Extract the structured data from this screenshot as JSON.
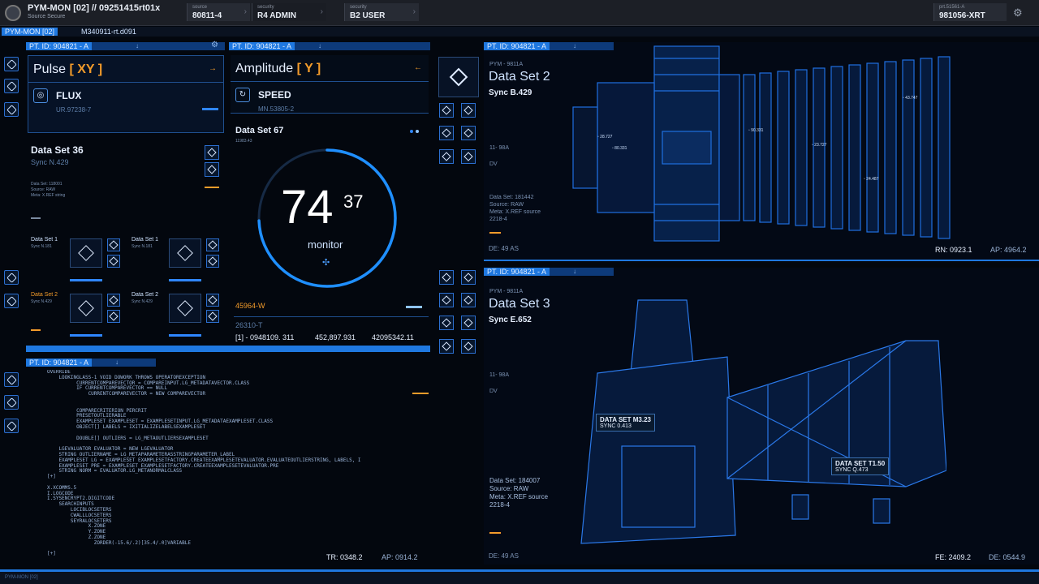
{
  "topbar": {
    "app_title": "PYM-MON [02] // 09251415rt01x",
    "app_subtitle": "Source Secure",
    "segments": [
      {
        "small": "source",
        "big": "80811-4"
      },
      {
        "small": "security",
        "big": "R4 ADMIN"
      },
      {
        "small": "security",
        "big": "B2 USER"
      }
    ],
    "right_small": "prt.51561-A",
    "right_big": "981056-XRT"
  },
  "subbar": {
    "tag": "PYM-MON [02]",
    "path": "M340911-rt.d091"
  },
  "panel_tab": "PT. ID: 904821 - A",
  "pulse": {
    "title": "Pulse",
    "tag": "[ XY ]",
    "item": "FLUX",
    "item_sub": "UR.97238-7"
  },
  "amplitude": {
    "title": "Amplitude",
    "tag": "[ Y ]",
    "item": "SPEED",
    "item_sub": "MN.53805-2"
  },
  "ds36": {
    "title": "Data Set 36",
    "sync": "Sync N.429",
    "lines": [
      "Data Set: 118001",
      "Source: RAW",
      "Meta: X.REF string"
    ]
  },
  "ds_tiles": [
    {
      "title": "Data Set 1",
      "sync": "Sync N.181"
    },
    {
      "title": "Data Set 1",
      "sync": "Sync N.181"
    },
    {
      "title": "Data Set 2",
      "sync": "Sync N.429"
    },
    {
      "title": "Data Set 2",
      "sync": "Sync N.429"
    }
  ],
  "gauge": {
    "title": "Data Set 67",
    "sub": "11983.43",
    "major": "74",
    "minor": "37",
    "label": "monitor",
    "value_pct": 74.37,
    "orange": "45964-W",
    "code": "26310-T",
    "readout": [
      "[1] - 0948109. 311",
      "452,897.931",
      "42095342.11"
    ]
  },
  "ds2": {
    "tag": "PYM - 9811A",
    "title": "Data Set 2",
    "sync": "Sync B.429",
    "mid": "11- 98A",
    "dv": "DV",
    "lines": [
      "Data Set: 181442",
      "Source: RAW",
      "Meta: X.REF source",
      "2218-4"
    ],
    "de": "DE: 49 AS",
    "rn": "RN: 0923.1",
    "ap": "AP: 4964.2",
    "markers": [
      "28.727",
      "80.331",
      "90.331",
      "23.727",
      "43.747",
      "24.487"
    ]
  },
  "ds3": {
    "tag": "PYM - 9811A",
    "title": "Data Set 3",
    "sync": "Sync E.652",
    "mid": "11- 98A",
    "dv": "DV",
    "lines": [
      "Data Set: 184007",
      "Source: RAW",
      "Meta: X.REF source",
      "2218-4"
    ],
    "de": "DE: 49 AS",
    "fe": "FE: 2409.2",
    "de2": "DE: 0544.9",
    "callout1": {
      "title": "DATA SET M3.23",
      "sub": "SYNC 0.413"
    },
    "callout2": {
      "title": "DATA SET T1.50",
      "sub": "SYNC Q.473"
    }
  },
  "code": {
    "lines": [
      "OVERRIDE",
      "    LOOKINGLASS-1 VOID DOWORK THROWS OPERATOREXCEPTION",
      "          CURRENTCOMPAREVECTOR = COMPAREINPUT.LG_METADATAVECTOR.CLASS",
      "          IF CURRENTCOMPAREVECTOR == NULL",
      "              CURRENTCOMPAREVECTOR = NEW COMPAREVECTOR",
      "",
      "",
      "          COMPARECRITERION PERCRIT",
      "          PRESETOUTLIERABLE",
      "          EXAMPLESET EXAMPLESET = EXAMPLESETINPUT.LG_METADATAEXAMPLESET.CLASS",
      "          OBJECT[] LABELS = IXITIALIZELABELSEXAMPLESET",
      "",
      "          DOUBLE[] OUTLIERS = LG_METAOUTLIERSEXAMPLESET",
      "",
      "    LGEVALUATOR EVALUATOR = NEW LGEVALUATOR",
      "    STRING OUTLIERNAME = LG_METAPARAMETERASSTRINGPARAMETER_LABEL",
      "    EXAMPLESET LG = EXAMPLESET EXAMPLESETFACTORY.CREATEEXAMPLESETEVALUATOR.EVALUATEOUTLIERSTRING, LABELS, I",
      "    EXAMPLESET PRE = EXAMPLESET EXAMPLESETFACTORY.CREATEEXAMPLESETEVALUATOR.PRE",
      "    STRING NORM = EVALUATOR.LG_METANORMALCLASS",
      "[+]",
      "",
      "X.XCOMMS.5",
      "I.LOGCODE",
      "I.SYSENCRYPT2.DIGITCODE",
      "    SEARCHINPUTS",
      "        LOCIBLOCSETERS",
      "        CWALLLOCSETERS",
      "        SEYRALOCSETERS",
      "              X.ZONE",
      "              Y.ZONE",
      "              Z.ZONE",
      "                ZORDER(-15.6/.2)[35.4/.0]VARIABLE",
      "",
      "[+]"
    ],
    "tr": "TR: 0348.2",
    "ap": "AP: 0914.2"
  },
  "bottombar": "PYM-MON [02]"
}
